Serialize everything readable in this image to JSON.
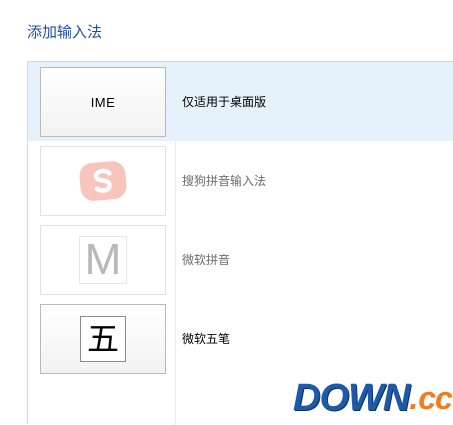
{
  "page": {
    "title": "添加输入法"
  },
  "ime_list": [
    {
      "tile_text": "IME",
      "label": "仅适用于桌面版",
      "selected": true,
      "enabled": true
    },
    {
      "tile_icon": "sogou-logo-icon",
      "label": "搜狗拼音输入法",
      "selected": false,
      "enabled": false
    },
    {
      "tile_icon": "m-letter-icon",
      "tile_glyph": "M",
      "label": "微软拼音",
      "selected": false,
      "enabled": false
    },
    {
      "tile_icon": "wubi-character-icon",
      "tile_glyph": "五",
      "label": "微软五笔",
      "selected": false,
      "enabled": true
    }
  ],
  "watermark": {
    "main": "DOWN",
    "dot": ".",
    "suffix": "cc"
  },
  "colors": {
    "title": "#1f4f9f",
    "selected_row": "#e5f1fb",
    "sogou": "#f7c5bb",
    "watermark_blue": "#1f5aa8",
    "watermark_orange": "#f47a1f"
  }
}
